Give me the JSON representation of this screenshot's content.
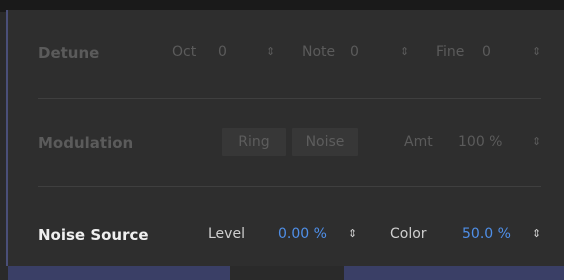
{
  "detune": {
    "title": "Detune",
    "oct_label": "Oct",
    "oct_value": "0",
    "note_label": "Note",
    "note_value": "0",
    "fine_label": "Fine",
    "fine_value": "0"
  },
  "modulation": {
    "title": "Modulation",
    "ring_label": "Ring",
    "noise_label": "Noise",
    "amt_label": "Amt",
    "amt_value": "100 %"
  },
  "noise_source": {
    "title": "Noise Source",
    "level_label": "Level",
    "level_value": "0.00 %",
    "color_label": "Color",
    "color_value": "50.0 %"
  },
  "icons": {
    "spinner": "⇕",
    "spinner_glyph": "≑"
  },
  "colors": {
    "accent": "#4f8fe8",
    "background": "#2e2e2e",
    "disabled_text": "#5b5b5b"
  }
}
